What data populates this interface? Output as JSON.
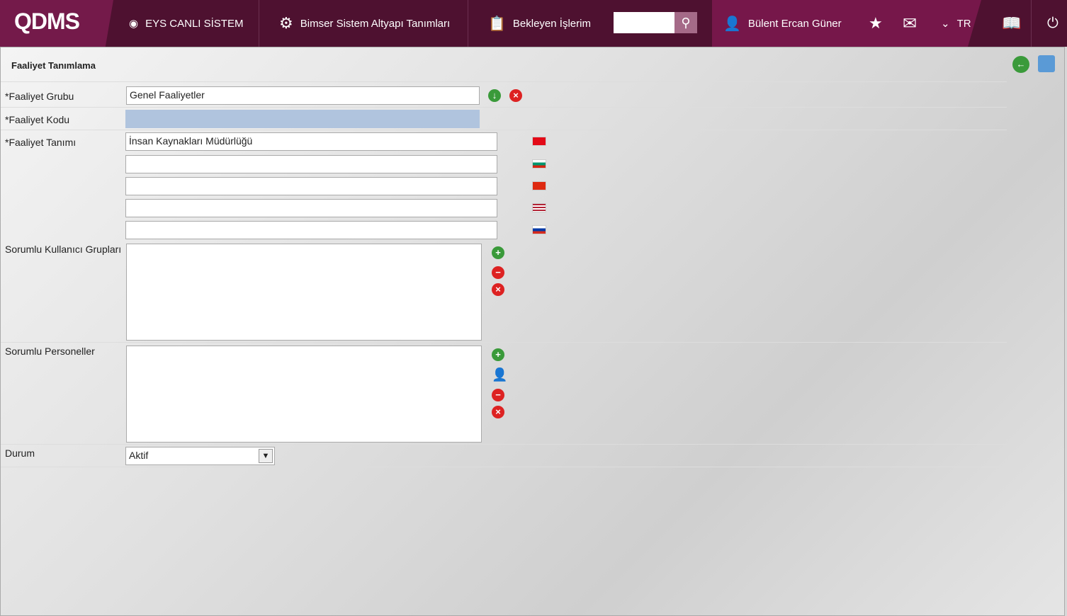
{
  "header": {
    "logo": "QDMS",
    "nav": [
      "EYS CANLI SİSTEM",
      "Bimser Sistem Altyapı Tanımları",
      "Bekleyen İşlerim"
    ],
    "search_placeholder": "",
    "user": "Bülent Ercan Güner",
    "lang": "TR"
  },
  "page": {
    "title": "Faaliyet Tanımlama"
  },
  "form": {
    "grup_label": "*Faaliyet Grubu",
    "grup_value": "Genel Faaliyetler",
    "kod_label": "*Faaliyet Kodu",
    "kod_value": "",
    "tanim_label": "*Faaliyet Tanımı",
    "tanim_value": "İnsan Kaynakları Müdürlüğü",
    "groups_label": "Sorumlu Kullanıcı Grupları",
    "personel_label": "Sorumlu Personeller",
    "durum_label": "Durum",
    "durum_value": "Aktif"
  }
}
